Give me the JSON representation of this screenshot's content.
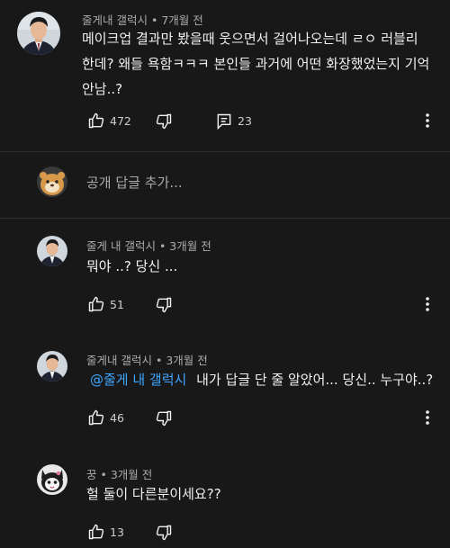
{
  "comment": {
    "author": "줄게내 갤럭시",
    "time": "7개월 전",
    "lines": [
      "메이크업 결과만 봤을때 웃으면서 걸어나오는데 ㄹㅇ 러블리",
      "한데? 왜들 욕함ㅋㅋㅋ 본인들 과거에 어떤 화장했었는지 기억",
      "안남..?"
    ],
    "likes": "472",
    "replies": "23"
  },
  "reply_input": {
    "placeholder": "공개 답글 추가..."
  },
  "replies": [
    {
      "author": "줄게 내 갤럭시",
      "time": "3개월 전",
      "text": "뭐야 ..? 당신 ...",
      "likes": "51"
    },
    {
      "author": "줄게내 갤럭시",
      "time": "3개월 전",
      "mention": "@줄게 내 갤럭시",
      "text": "내가 답글 단 줄 알았어... 당신.. 누구야..?",
      "likes": "46"
    },
    {
      "author": "꿍",
      "time": "3개월 전",
      "text": "헐 둘이 다른분이세요??",
      "likes": "13"
    }
  ],
  "separator": "•",
  "icons": [
    "like-icon",
    "dislike-icon",
    "reply-icon",
    "more-icon"
  ],
  "colors": {
    "background": "#181818",
    "mention": "#3ea6ff",
    "meta": "#aaaaaa"
  }
}
